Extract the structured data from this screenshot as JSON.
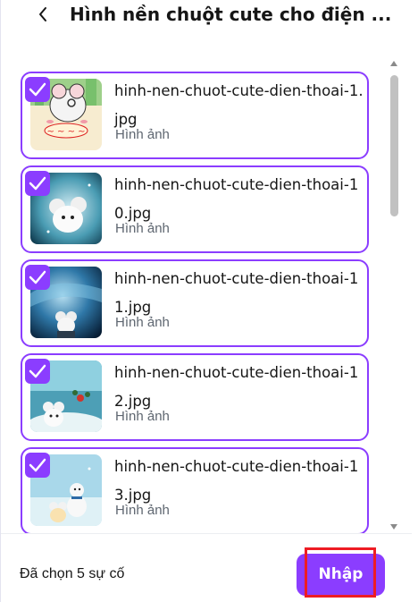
{
  "header": {
    "title": "Hình nền chuột cute cho điện ...",
    "back_icon": "chevron-left-icon"
  },
  "files": [
    {
      "name": "hinh-nen-chuot-cute-dien-thoai-1.jpg",
      "type": "Hình ảnh",
      "selected": true
    },
    {
      "name": "hinh-nen-chuot-cute-dien-thoai-10.jpg",
      "type": "Hình ảnh",
      "selected": true
    },
    {
      "name": "hinh-nen-chuot-cute-dien-thoai-11.jpg",
      "type": "Hình ảnh",
      "selected": true
    },
    {
      "name": "hinh-nen-chuot-cute-dien-thoai-12.jpg",
      "type": "Hình ảnh",
      "selected": true
    },
    {
      "name": "hinh-nen-chuot-cute-dien-thoai-13.jpg",
      "type": "Hình ảnh",
      "selected": true
    }
  ],
  "footer": {
    "status": "Đã chọn 5 sự cố",
    "import_label": "Nhập"
  },
  "colors": {
    "accent": "#8b3dff",
    "highlight": "#ee1c24"
  }
}
